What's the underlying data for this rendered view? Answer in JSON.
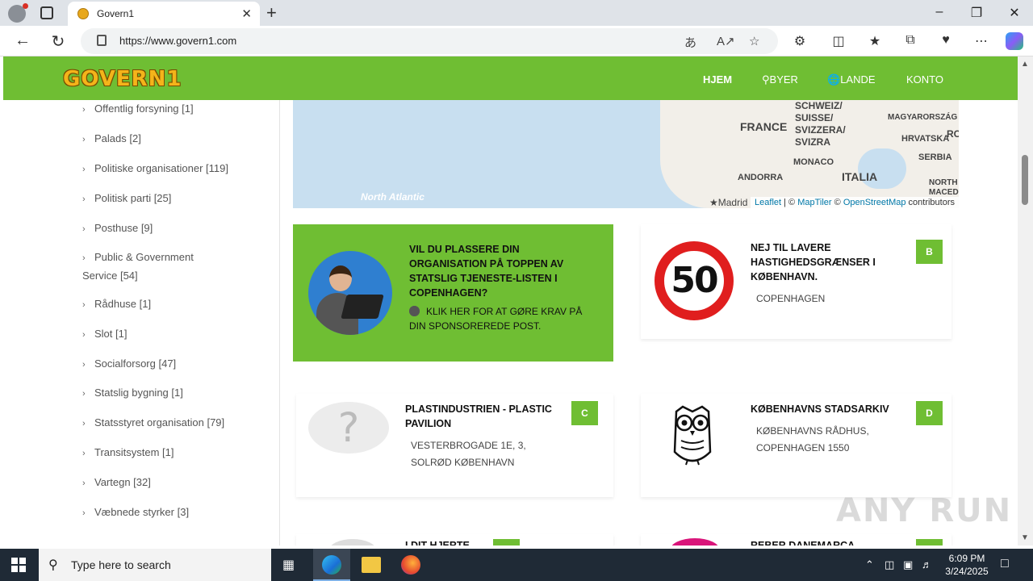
{
  "browser": {
    "tab_title": "Govern1",
    "url": "https://www.govern1.com",
    "close_glyph": "✕",
    "newtab_glyph": "+"
  },
  "site": {
    "logo": "GOVERN1",
    "nav": [
      "HJEM",
      "BYER",
      "LANDE",
      "KONTO"
    ]
  },
  "sidebar": {
    "categories": [
      "Offentlig forsyning [1]",
      "Palads [2]",
      "Politiske organisationer [119]",
      "Politisk parti [25]",
      "Posthuse [9]",
      "Public & Government Service [54]",
      "Rådhuse [1]",
      "Slot [1]",
      "Socialforsorg [47]",
      "Statslig bygning [1]",
      "Statsstyret organisation [79]",
      "Transitsystem [1]",
      "Vartegn [32]",
      "Væbnede styrker [3]"
    ]
  },
  "map": {
    "labels": [
      "FRANCE",
      "SCHWEIZ/ SUISSE/ SVIZZERA/ SVIZRA",
      "MAGYARORSZÁG",
      "HRVATSKA",
      "SERBIA",
      "MONACO",
      "ANDORRA",
      "ITALIA",
      "Madrid",
      "North Atlantic",
      "RO",
      "NORTH MACEDON"
    ],
    "attribution": {
      "leaflet": "Leaflet",
      "sep1": " | © ",
      "maptiler": "MapTiler",
      "sep2": " © ",
      "osm": "OpenStreetMap",
      "tail": " contributors"
    }
  },
  "promo": {
    "headline": "VIL DU PLASSERE DIN ORGANISATION PÅ TOPPEN AV STATSLIG TJENESTE-LISTEN I COPENHAGEN?",
    "claim": "KLIK HER FOR AT GØRE KRAV PÅ DIN SPONSOREREDE POST."
  },
  "listings": [
    {
      "badge": "B",
      "title": "NEJ TIL LAVERE HASTIGHEDSGRÆNSER I KØBENHAVN.",
      "address": "COPENHAGEN",
      "image_text": "50"
    },
    {
      "badge": "C",
      "title": "PLASTINDUSTRIEN - PLASTIC PAVILION",
      "address": "VESTERBROGADE 1E, 3, SOLRØD KØBENHAVN",
      "image_text": "?"
    },
    {
      "badge": "D",
      "title": "KØBENHAVNS STADSARKIV",
      "address": "KØBENHAVNS RÅDHUS, COPENHAGEN 1550",
      "image_text": ""
    },
    {
      "badge": "",
      "title": "I DIT HJERTE",
      "address": ""
    },
    {
      "badge": "",
      "title": "REBER DANEMARCA",
      "address": ""
    }
  ],
  "watermark": "ANY RUN",
  "taskbar": {
    "search_placeholder": "Type here to search",
    "time": "6:09 PM",
    "date": "3/24/2025"
  },
  "colors": {
    "brand_green": "#6fbe33",
    "badge_green": "#6fbe33",
    "speed_red": "#e01e1e"
  }
}
